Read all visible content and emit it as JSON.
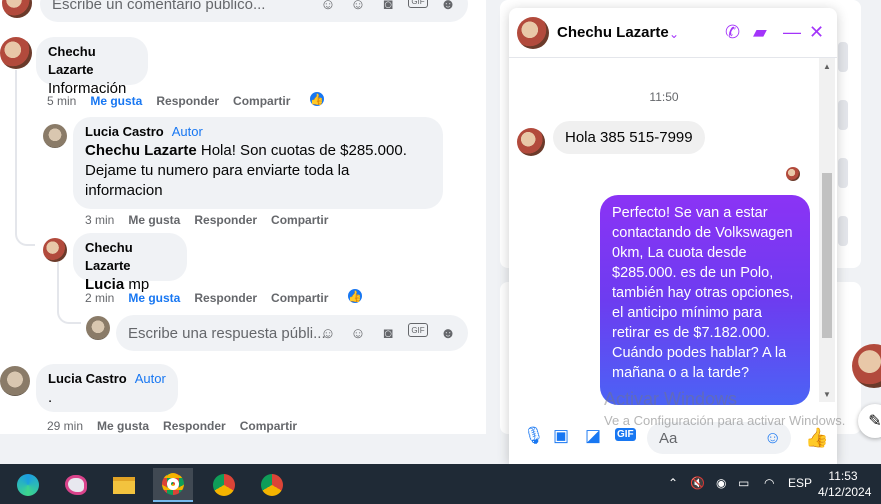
{
  "comments": {
    "top_input_placeholder": "Escribe un comentario público...",
    "items": [
      {
        "author": "Chechu Lazarte",
        "text": "Información",
        "time": "5 min",
        "like": "Me gusta",
        "reply": "Responder",
        "share": "Compartir"
      },
      {
        "author": "Lucia Castro",
        "role": "Autor",
        "mention": "Chechu Lazarte",
        "text": "Hola! Son cuotas de $285.000. Dejame tu numero para enviarte toda la informacion",
        "time": "3 min",
        "like": "Me gusta",
        "reply": "Responder",
        "share": "Compartir"
      },
      {
        "author": "Chechu Lazarte",
        "mention": "Lucia",
        "text": "mp",
        "time": "2 min",
        "like": "Me gusta",
        "reply": "Responder",
        "share": "Compartir"
      },
      {
        "author": "Lucia Castro",
        "role": "Autor",
        "text": ".",
        "time": "29 min",
        "like": "Me gusta",
        "reply": "Responder",
        "share": "Compartir"
      }
    ],
    "reply_input_placeholder": "Escribe una respuesta públi...",
    "input_icons": [
      "sticker-icon",
      "emoji-icon",
      "camera-icon",
      "gif-icon",
      "avatar-sticker-icon"
    ]
  },
  "chat": {
    "name": "Chechu Lazarte",
    "time": "11:50",
    "incoming": "Hola 385 515-7999",
    "outgoing": "Perfecto!  Se van a estar contactando de Volkswagen 0km, La cuota desde $285.000. es de un Polo, también hay otras opciones, el anticipo mínimo para retirar es de $7.182.000. Cuándo podes hablar? A la mañana o a la tarde?",
    "input_placeholder": "Aa",
    "accent": "#a334fa"
  },
  "watermark": {
    "line1": "Activar Windows",
    "line2": "Ve a Configuración para activar Windows."
  },
  "taskbar": {
    "lang": "ESP",
    "time": "11:53",
    "date": "4/12/2024"
  }
}
